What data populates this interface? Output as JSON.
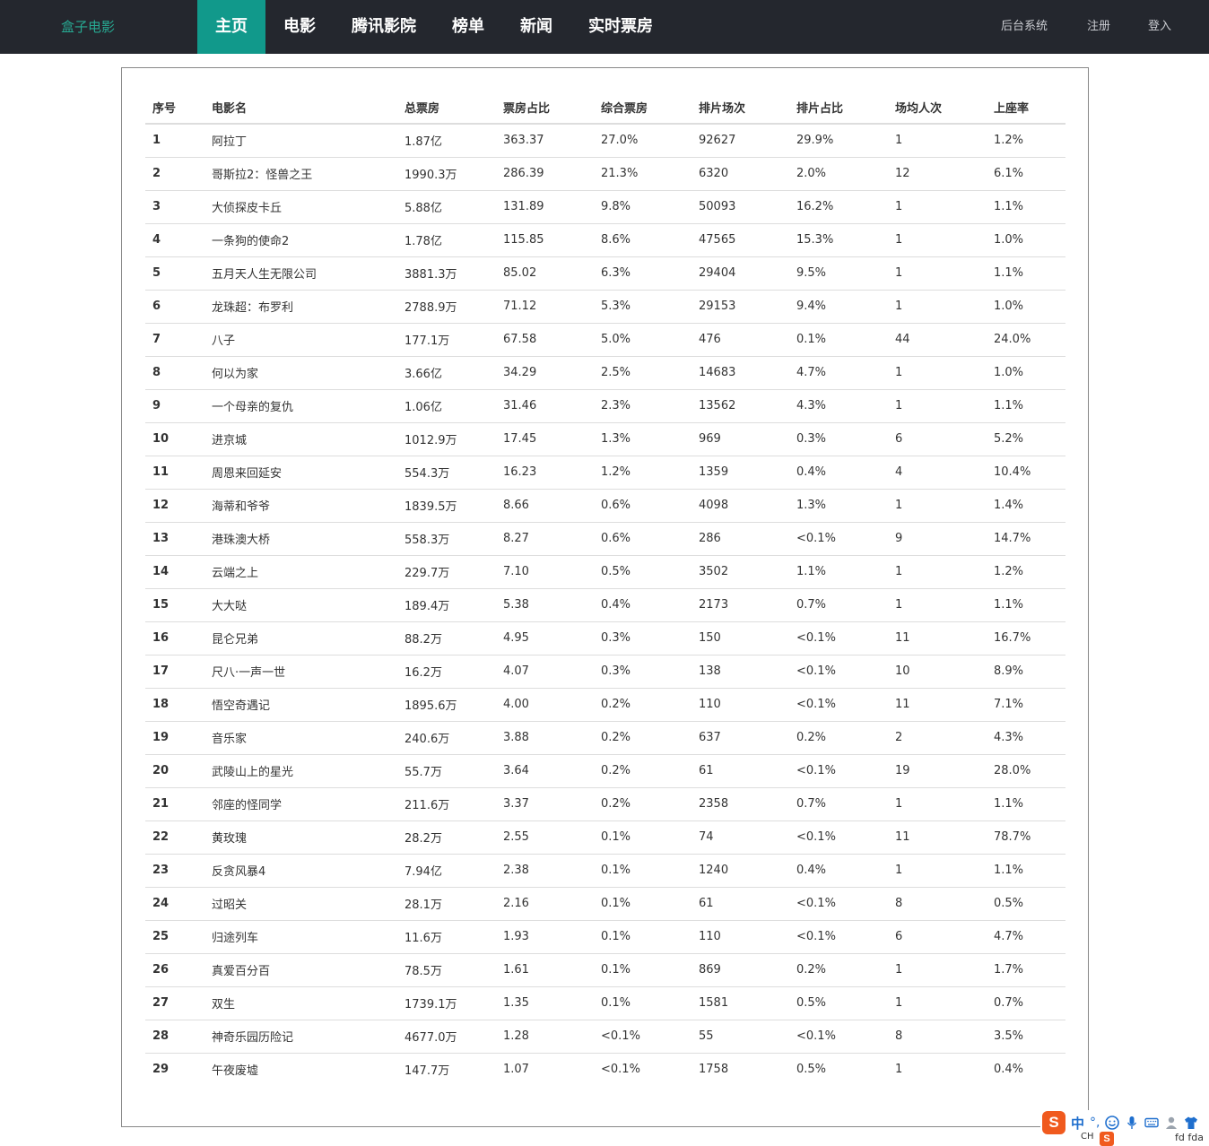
{
  "brand": "盒子电影",
  "nav": {
    "items": [
      "主页",
      "电影",
      "腾讯影院",
      "榜单",
      "新闻",
      "实时票房"
    ],
    "active_index": 0,
    "right": [
      "后台系统",
      "注册",
      "登入"
    ]
  },
  "colors": {
    "navbar_bg": "#24272e",
    "active_tab": "#11998b",
    "brand": "#27a992"
  },
  "table": {
    "headers": [
      "序号",
      "电影名",
      "总票房",
      "票房占比",
      "综合票房",
      "排片场次",
      "排片占比",
      "场均人次",
      "上座率"
    ],
    "rows": [
      [
        "1",
        "阿拉丁",
        "1.87亿",
        "363.37",
        "27.0%",
        "92627",
        "29.9%",
        "1",
        "1.2%"
      ],
      [
        "2",
        "哥斯拉2：怪兽之王",
        "1990.3万",
        "286.39",
        "21.3%",
        "6320",
        "2.0%",
        "12",
        "6.1%"
      ],
      [
        "3",
        "大侦探皮卡丘",
        "5.88亿",
        "131.89",
        "9.8%",
        "50093",
        "16.2%",
        "1",
        "1.1%"
      ],
      [
        "4",
        "一条狗的使命2",
        "1.78亿",
        "115.85",
        "8.6%",
        "47565",
        "15.3%",
        "1",
        "1.0%"
      ],
      [
        "5",
        "五月天人生无限公司",
        "3881.3万",
        "85.02",
        "6.3%",
        "29404",
        "9.5%",
        "1",
        "1.1%"
      ],
      [
        "6",
        "龙珠超：布罗利",
        "2788.9万",
        "71.12",
        "5.3%",
        "29153",
        "9.4%",
        "1",
        "1.0%"
      ],
      [
        "7",
        "八子",
        "177.1万",
        "67.58",
        "5.0%",
        "476",
        "0.1%",
        "44",
        "24.0%"
      ],
      [
        "8",
        "何以为家",
        "3.66亿",
        "34.29",
        "2.5%",
        "14683",
        "4.7%",
        "1",
        "1.0%"
      ],
      [
        "9",
        "一个母亲的复仇",
        "1.06亿",
        "31.46",
        "2.3%",
        "13562",
        "4.3%",
        "1",
        "1.1%"
      ],
      [
        "10",
        "进京城",
        "1012.9万",
        "17.45",
        "1.3%",
        "969",
        "0.3%",
        "6",
        "5.2%"
      ],
      [
        "11",
        "周恩来回延安",
        "554.3万",
        "16.23",
        "1.2%",
        "1359",
        "0.4%",
        "4",
        "10.4%"
      ],
      [
        "12",
        "海蒂和爷爷",
        "1839.5万",
        "8.66",
        "0.6%",
        "4098",
        "1.3%",
        "1",
        "1.4%"
      ],
      [
        "13",
        "港珠澳大桥",
        "558.3万",
        "8.27",
        "0.6%",
        "286",
        "<0.1%",
        "9",
        "14.7%"
      ],
      [
        "14",
        "云端之上",
        "229.7万",
        "7.10",
        "0.5%",
        "3502",
        "1.1%",
        "1",
        "1.2%"
      ],
      [
        "15",
        "大大哒",
        "189.4万",
        "5.38",
        "0.4%",
        "2173",
        "0.7%",
        "1",
        "1.1%"
      ],
      [
        "16",
        "昆仑兄弟",
        "88.2万",
        "4.95",
        "0.3%",
        "150",
        "<0.1%",
        "11",
        "16.7%"
      ],
      [
        "17",
        "尺八·一声一世",
        "16.2万",
        "4.07",
        "0.3%",
        "138",
        "<0.1%",
        "10",
        "8.9%"
      ],
      [
        "18",
        "悟空奇遇记",
        "1895.6万",
        "4.00",
        "0.2%",
        "110",
        "<0.1%",
        "11",
        "7.1%"
      ],
      [
        "19",
        "音乐家",
        "240.6万",
        "3.88",
        "0.2%",
        "637",
        "0.2%",
        "2",
        "4.3%"
      ],
      [
        "20",
        "武陵山上的星光",
        "55.7万",
        "3.64",
        "0.2%",
        "61",
        "<0.1%",
        "19",
        "28.0%"
      ],
      [
        "21",
        "邻座的怪同学",
        "211.6万",
        "3.37",
        "0.2%",
        "2358",
        "0.7%",
        "1",
        "1.1%"
      ],
      [
        "22",
        "黄玫瑰",
        "28.2万",
        "2.55",
        "0.1%",
        "74",
        "<0.1%",
        "11",
        "78.7%"
      ],
      [
        "23",
        "反贪风暴4",
        "7.94亿",
        "2.38",
        "0.1%",
        "1240",
        "0.4%",
        "1",
        "1.1%"
      ],
      [
        "24",
        "过昭关",
        "28.1万",
        "2.16",
        "0.1%",
        "61",
        "<0.1%",
        "8",
        "0.5%"
      ],
      [
        "25",
        "归途列车",
        "11.6万",
        "1.93",
        "0.1%",
        "110",
        "<0.1%",
        "6",
        "4.7%"
      ],
      [
        "26",
        "真爱百分百",
        "78.5万",
        "1.61",
        "0.1%",
        "869",
        "0.2%",
        "1",
        "1.7%"
      ],
      [
        "27",
        "双生",
        "1739.1万",
        "1.35",
        "0.1%",
        "1581",
        "0.5%",
        "1",
        "0.7%"
      ],
      [
        "28",
        "神奇乐园历险记",
        "4677.0万",
        "1.28",
        "<0.1%",
        "55",
        "<0.1%",
        "8",
        "3.5%"
      ],
      [
        "29",
        "午夜废墟",
        "147.7万",
        "1.07",
        "<0.1%",
        "1758",
        "0.5%",
        "1",
        "0.4%"
      ]
    ]
  },
  "ime": {
    "logo": "S",
    "mode": "中",
    "punct": "°,",
    "locale": "CH",
    "tail": "fd fda"
  }
}
